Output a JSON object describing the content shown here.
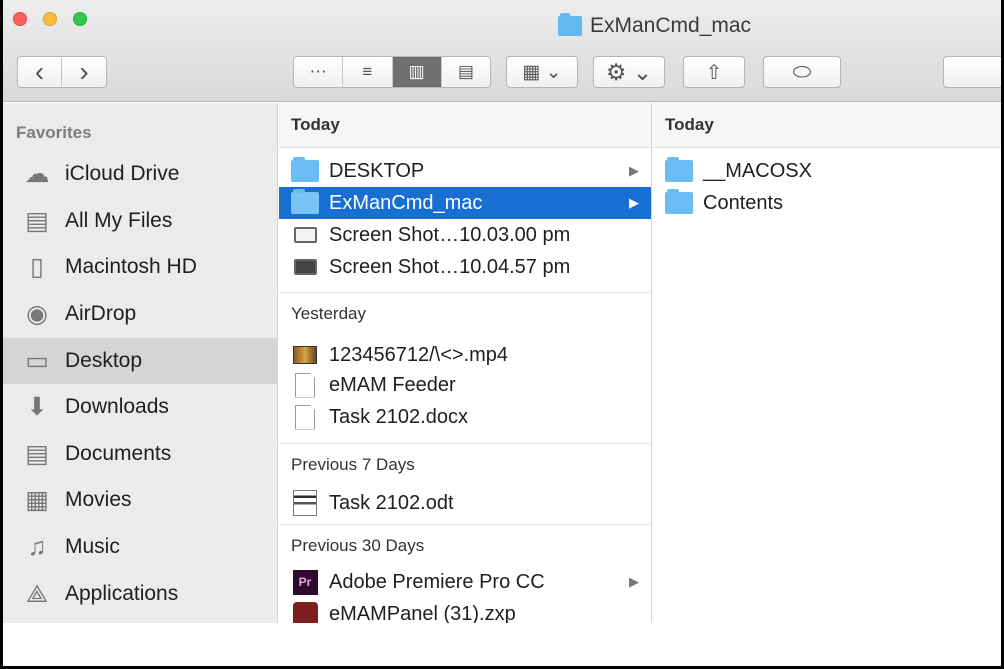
{
  "window": {
    "title": "ExManCmd_mac"
  },
  "toolbar": {
    "back": "‹",
    "forward": "›",
    "views": [
      "⋯",
      "≡",
      "▥",
      "▤"
    ],
    "arrange": "▦ ⌄",
    "action": "⚙ ⌄",
    "share": "⇧",
    "tag": "⬭"
  },
  "sidebar": {
    "title": "Favorites",
    "items": [
      {
        "label": "iCloud Drive",
        "icon": "cloud-icon",
        "glyph": "☁"
      },
      {
        "label": "All My Files",
        "icon": "all-files-icon",
        "glyph": "▤"
      },
      {
        "label": "Macintosh HD",
        "icon": "disk-icon",
        "glyph": "▯"
      },
      {
        "label": "AirDrop",
        "icon": "airdrop-icon",
        "glyph": "◉"
      },
      {
        "label": "Desktop",
        "icon": "desktop-icon",
        "glyph": "▭"
      },
      {
        "label": "Downloads",
        "icon": "downloads-icon",
        "glyph": "⬇"
      },
      {
        "label": "Documents",
        "icon": "documents-icon",
        "glyph": "▤"
      },
      {
        "label": "Movies",
        "icon": "movies-icon",
        "glyph": "▦"
      },
      {
        "label": "Music",
        "icon": "music-icon",
        "glyph": "♫"
      },
      {
        "label": "Applications",
        "icon": "applications-icon",
        "glyph": "⟁"
      }
    ]
  },
  "column1": {
    "today": "Today",
    "today_items": [
      {
        "label": "DESKTOP",
        "chevron": "▶"
      },
      {
        "label": "ExManCmd_mac",
        "chevron": "▶"
      },
      {
        "label": "Screen Shot…10.03.00 pm"
      },
      {
        "label": "Screen Shot…10.04.57 pm"
      }
    ],
    "yesterday": "Yesterday",
    "yesterday_items": [
      {
        "label": "123456712/\\<>.mp4"
      },
      {
        "label": "eMAM Feeder"
      },
      {
        "label": "Task 2102.docx"
      }
    ],
    "previous7": "Previous 7 Days",
    "previous7_items": [
      {
        "label": "Task 2102.odt"
      }
    ],
    "previous30": "Previous 30 Days",
    "previous30_items": [
      {
        "label": "Adobe Premiere Pro CC",
        "chevron": "▶",
        "icon_text": "Pr"
      },
      {
        "label": "eMAMPanel (31).zxp"
      }
    ]
  },
  "column2": {
    "today": "Today",
    "items": [
      {
        "label": "__MACOSX"
      },
      {
        "label": "Contents"
      }
    ]
  }
}
